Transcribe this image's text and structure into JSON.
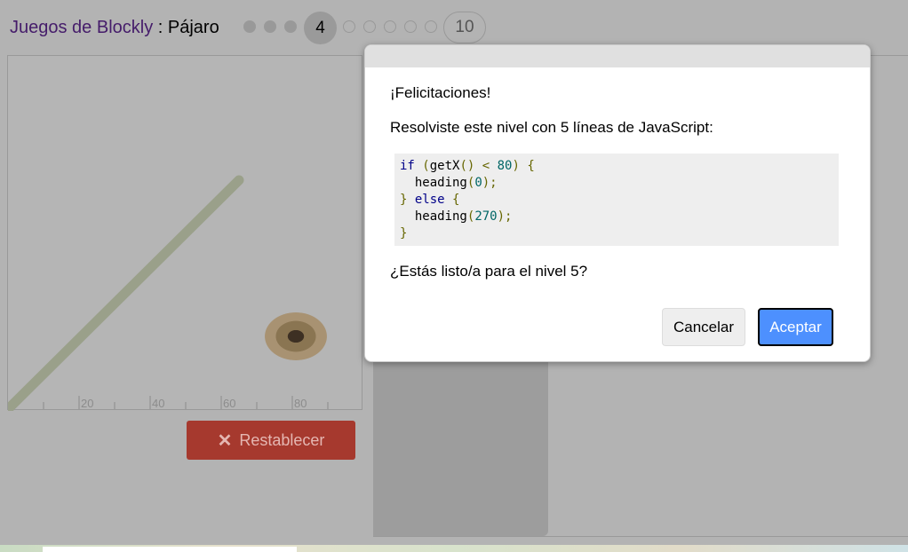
{
  "header": {
    "app_name": "Juegos de Blockly",
    "separator": " : ",
    "game_name": "Pájaro",
    "current_level": "4",
    "last_level": "10"
  },
  "visualization": {
    "axis_labels": [
      "20",
      "40",
      "60",
      "80"
    ]
  },
  "reset_button": {
    "icon": "close-icon",
    "label": "Restablecer"
  },
  "dialog": {
    "congrats": "¡Felicitaciones!",
    "solved_text": "Resolviste este nivel con 5 líneas de JavaScript:",
    "code_lines": [
      "if (getX() < 80) {",
      "  heading(0);",
      "} else {",
      "  heading(270);",
      "}"
    ],
    "question": "¿Estás listo/a para el nivel 5?",
    "cancel_label": "Cancelar",
    "ok_label": "Aceptar"
  }
}
